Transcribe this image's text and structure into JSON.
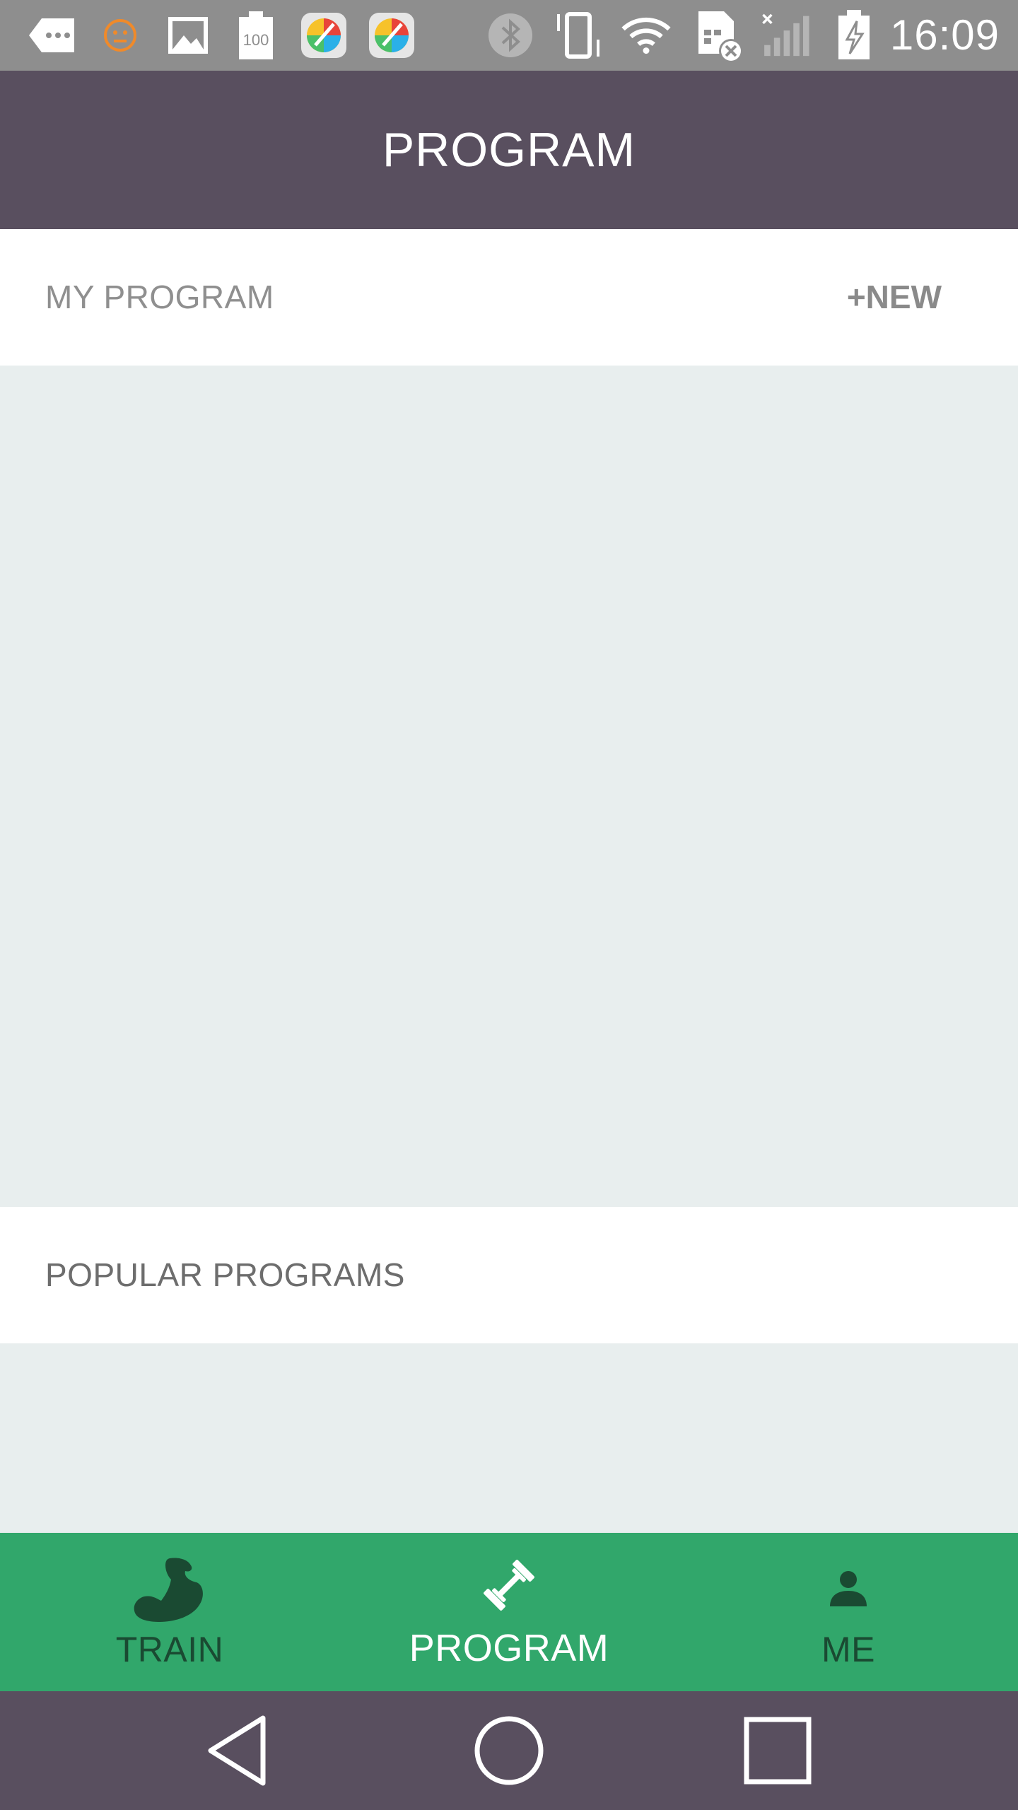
{
  "status_bar": {
    "time": "16:09",
    "left_icons": [
      "more-dots-icon",
      "face-icon",
      "image-icon",
      "battery-100-icon",
      "app-launcher-icon",
      "app-launcher-icon"
    ],
    "right_icons": [
      "bluetooth-icon",
      "vibrate-icon",
      "wifi-icon",
      "sim-off-icon",
      "signal-none-icon",
      "battery-charging-icon"
    ],
    "battery_badge": "100"
  },
  "app_bar": {
    "title": "PROGRAM"
  },
  "my_program": {
    "title": "MY PROGRAM",
    "new_label": "+NEW"
  },
  "popular": {
    "title": "POPULAR PROGRAMS"
  },
  "bottom_nav": {
    "items": [
      {
        "label": "TRAIN",
        "icon": "muscle-arm-icon",
        "active": false
      },
      {
        "label": "PROGRAM",
        "icon": "dumbbell-icon",
        "active": true
      },
      {
        "label": "ME",
        "icon": "person-icon",
        "active": false
      }
    ]
  },
  "colors": {
    "status_bar": "#8e8e8e",
    "app_bar": "#594f5f",
    "background": "#e8eeee",
    "bottom_nav": "#31a76b",
    "nav_inactive": "#1a4a32",
    "nav_active": "#ffffff"
  }
}
